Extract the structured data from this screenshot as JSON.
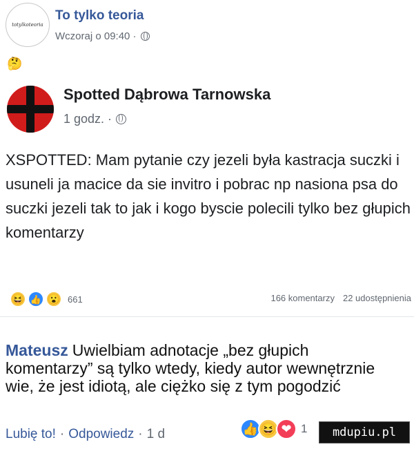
{
  "outer_post": {
    "author": "To tylko teoria",
    "avatar_text": "totylkoteoria",
    "timestamp": "Wczoraj o 09:40 ·",
    "emoji": "🤔"
  },
  "shared_post": {
    "author": "Spotted Dąbrowa Tarnowska",
    "timestamp": "1 godz. ·",
    "text": "XSPOTTED: Mam pytanie czy jezeli była kastracja suczki i usuneli ja macice da sie invitro i pobrac np nasiona psa do suczki jezeli tak to jak i kogo byscie polecili tylko bez głupich komentarzy",
    "reaction_count": "661",
    "comments_count": "166 komentarzy",
    "shares_count": "22 udostępnienia"
  },
  "comment": {
    "author": "Mateusz",
    "text": "Uwielbiam adnotacje „bez głupich komentarzy” są tylko wtedy, kiedy autor wewnętrznie wie, że jest idiotą, ale ciężko się z tym pogodzić",
    "like_label": "Lubię to!",
    "reply_label": "Odpowiedz",
    "time": "1 d",
    "reaction_count": "1"
  },
  "watermark": "mdupiu.pl",
  "icons": {
    "reaction_haha": "😆",
    "reaction_like": "👍",
    "reaction_wow": "😮",
    "reaction_love": "❤"
  }
}
